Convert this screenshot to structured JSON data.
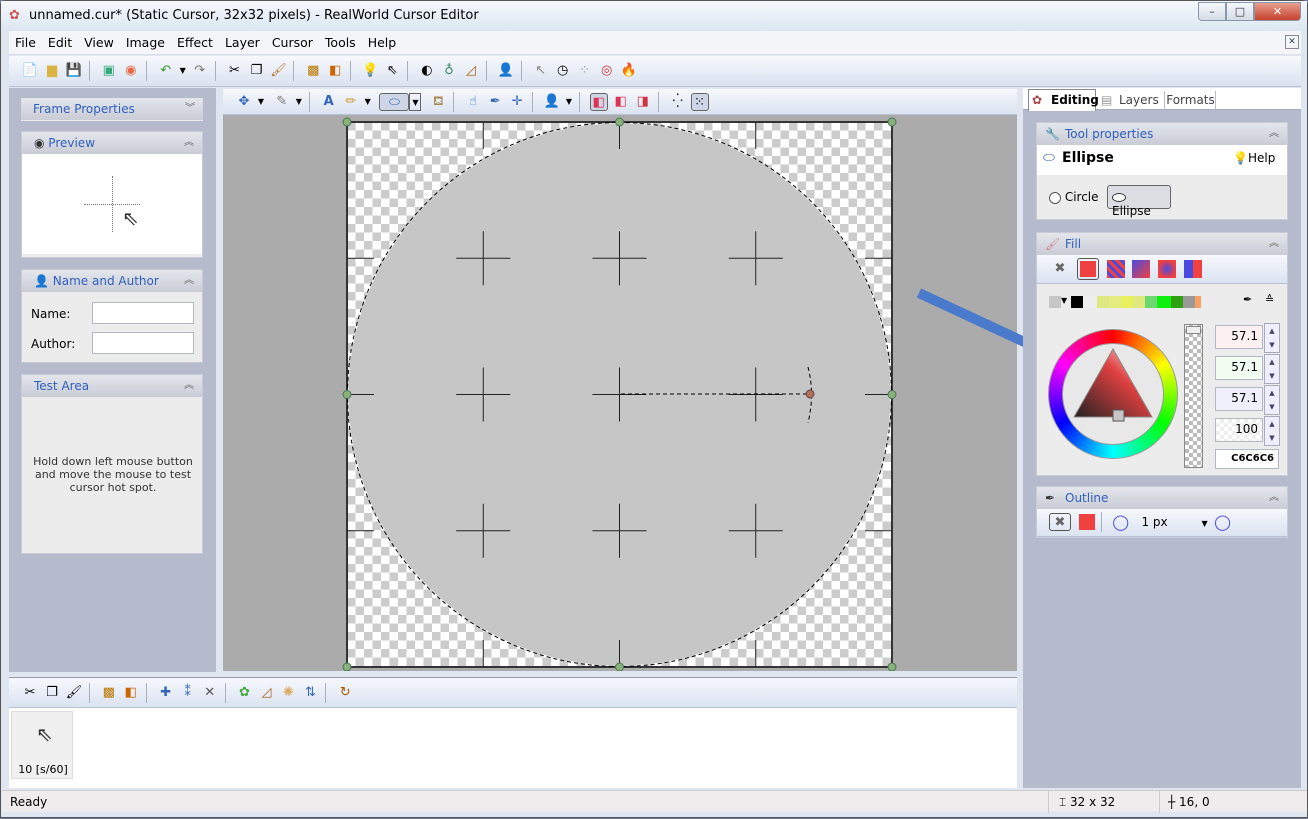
{
  "window": {
    "title": "unnamed.cur* (Static Cursor, 32x32 pixels) - RealWorld Cursor Editor",
    "minimize": "–",
    "maximize": "□",
    "close": "✕",
    "mdi_close": "✕"
  },
  "menu": [
    "File",
    "Edit",
    "View",
    "Image",
    "Effect",
    "Layer",
    "Cursor",
    "Tools",
    "Help"
  ],
  "main_toolbar_icons": [
    "new-icon",
    "open-icon",
    "save-icon",
    "save-all-icon",
    "sound-icon",
    "undo-icon",
    "redo-icon",
    "cut-icon",
    "copy-icon",
    "paste-icon",
    "layer-copy-icon",
    "layer-merge-icon",
    "hint-icon",
    "whats-this-icon",
    "contrast-icon",
    "globe-icon",
    "triangle-tool-icon",
    "user-icon",
    "arrow-cursor-icon",
    "stopwatch-icon",
    "busy-icon",
    "lifebuoy-icon",
    "fire-icon"
  ],
  "left": {
    "frame_properties": "Frame Properties",
    "preview": "Preview",
    "name_author": {
      "title": "Name and Author",
      "name_label": "Name:",
      "name_value": "",
      "author_label": "Author:",
      "author_value": ""
    },
    "test_area": {
      "title": "Test Area",
      "text": "Hold down left mouse button and move the mouse to test cursor hot spot."
    }
  },
  "right": {
    "tabs": [
      {
        "label": "Editing",
        "active": true
      },
      {
        "label": "Layers"
      },
      {
        "label": "Formats"
      }
    ],
    "tool_properties": {
      "title": "Tool properties",
      "tool": "Ellipse",
      "help": "Help",
      "options": [
        {
          "label": "Circle",
          "selected": false
        },
        {
          "label": "Ellipse",
          "selected": true
        }
      ]
    },
    "fill": {
      "title": "Fill",
      "values": [
        "57.1",
        "57.1",
        "57.1",
        "100"
      ],
      "hex": "C6C6C6",
      "color": "#c6c6c6"
    },
    "outline": {
      "title": "Outline",
      "width": "1 px"
    }
  },
  "bottom": {
    "frame_label": "10 [s/60]"
  },
  "status": {
    "text": "Ready",
    "size": "32 x 32",
    "position": "16, 0"
  },
  "colors": {
    "accent": "#2f5fbf",
    "fill_red": "#f04040",
    "arrow_blue": "#4a7acb",
    "arrow_green": "#6aa82e"
  }
}
